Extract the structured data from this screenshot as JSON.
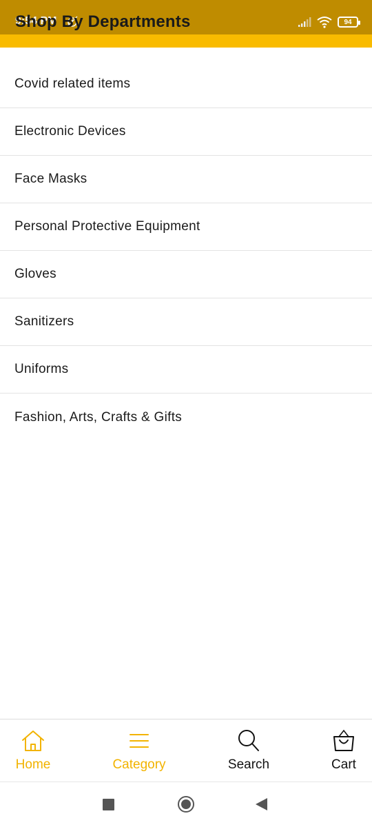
{
  "status_bar": {
    "time": "9:54 PM",
    "battery": "94",
    "icons": [
      "alarm-icon",
      "signal-icon",
      "wifi-icon",
      "battery-icon"
    ]
  },
  "header": {
    "title": "Shop By Departments"
  },
  "departments": [
    "Covid related items",
    "Electronic Devices",
    "Face Masks",
    "Personal Protective Equipment",
    "Gloves",
    "Sanitizers",
    "Uniforms",
    "Fashion, Arts, Crafts & Gifts"
  ],
  "bottom_nav": {
    "items": [
      {
        "label": "Home",
        "icon": "home-icon",
        "active": true
      },
      {
        "label": "Category",
        "icon": "menu-icon",
        "active": true
      },
      {
        "label": "Search",
        "icon": "search-icon",
        "active": false
      },
      {
        "label": "Cart",
        "icon": "shopping-bag-icon",
        "active": false
      }
    ]
  },
  "colors": {
    "status_bar": "#bf8c00",
    "accent": "#f9bb00",
    "nav_active": "#f2b300",
    "text": "#1a1a1a"
  }
}
